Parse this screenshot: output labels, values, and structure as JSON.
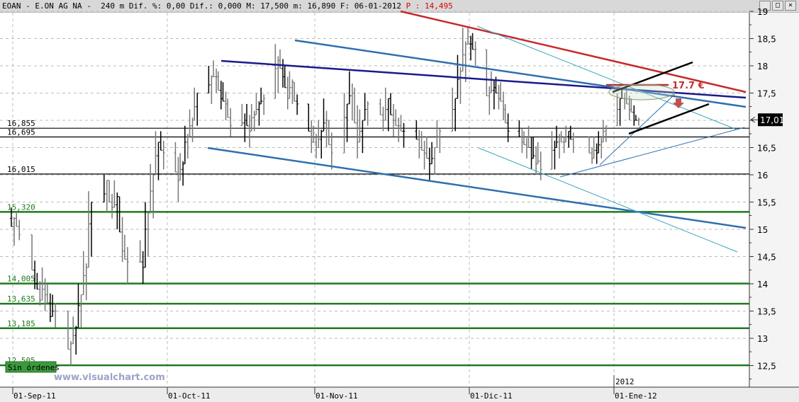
{
  "header": {
    "symbol": "EOAN - E.ON AG NA -",
    "stats": "240 m Dif. %: 0,00 Dif.: 0,000 M: 17,500 m: 16,890 F: 06-01-2012",
    "last": "P : 14,495",
    "window_buttons": [
      "minimize-icon",
      "maximize-icon",
      "close-icon"
    ]
  },
  "colors": {
    "support": "#1f7a1f",
    "resistance_red": "#c8282a",
    "navy": "#1a1a8c",
    "steel": "#2f6fae",
    "cyan": "#3aa7c0",
    "bars": "#000000"
  },
  "badge": "Sin órdenes",
  "watermark": "www.visualchart.com",
  "year_label": "2012",
  "annotation": "17.7 €",
  "chart_data": {
    "type": "ohlc",
    "interval": "240 m",
    "ylim": [
      12.2,
      19.0
    ],
    "yticks": [
      "19",
      "18,5",
      "18",
      "17,5",
      "17",
      "16,5",
      "16",
      "15,5",
      "15",
      "14,5",
      "14",
      "13,5",
      "13",
      "12,5"
    ],
    "ytick_values": [
      19,
      18.5,
      18,
      17.5,
      17,
      16.5,
      16,
      15.5,
      15,
      14.5,
      14,
      13.5,
      13,
      12.5
    ],
    "xticks": [
      {
        "date": "2011-09-01",
        "label": "01-Sep-11"
      },
      {
        "date": "2011-10-01",
        "label": "01-Oct-11"
      },
      {
        "date": "2011-11-01",
        "label": "01-Nov-11"
      },
      {
        "date": "2011-12-01",
        "label": "01-Dic-11"
      },
      {
        "date": "2012-01-01",
        "label": "01-Ene-12"
      }
    ],
    "grid": true,
    "current_price": "17,01",
    "levels": [
      {
        "value": 16.855,
        "label": "16,855",
        "color": "#000000"
      },
      {
        "value": 16.695,
        "label": "16,695",
        "color": "#000000"
      },
      {
        "value": 16.015,
        "label": "16,015",
        "color": "#000000"
      },
      {
        "value": 15.32,
        "label": "15,320",
        "color": "#1f7a1f"
      },
      {
        "value": 14.005,
        "label": "14,005",
        "color": "#1f7a1f"
      },
      {
        "value": 13.635,
        "label": "13,635",
        "color": "#1f7a1f"
      },
      {
        "value": 13.185,
        "label": "13,185",
        "color": "#1f7a1f"
      },
      {
        "value": 12.505,
        "label": "12,505",
        "color": "#1f7a1f"
      }
    ],
    "bars_hlc": [
      [
        "2011-09-01",
        15.4,
        14.7,
        15.2
      ],
      [
        "2011-09-02",
        15.3,
        14.8,
        14.9
      ],
      [
        "2011-09-05",
        14.6,
        13.9,
        14.0
      ],
      [
        "2011-09-06",
        14.2,
        13.6,
        13.7
      ],
      [
        "2011-09-07",
        14.3,
        13.5,
        13.8
      ],
      [
        "2011-09-08",
        14.0,
        13.3,
        13.4
      ],
      [
        "2011-09-09",
        13.8,
        13.2,
        13.5
      ],
      [
        "2011-09-12",
        13.1,
        12.5,
        12.9
      ],
      [
        "2011-09-13",
        13.4,
        12.7,
        13.2
      ],
      [
        "2011-09-14",
        14.0,
        13.2,
        13.8
      ],
      [
        "2011-09-15",
        14.6,
        13.7,
        14.3
      ],
      [
        "2011-09-16",
        15.7,
        14.5,
        15.5
      ],
      [
        "2011-09-19",
        16.0,
        15.3,
        15.9
      ],
      [
        "2011-09-20",
        15.8,
        15.2,
        15.4
      ],
      [
        "2011-09-21",
        15.9,
        15.0,
        15.6
      ],
      [
        "2011-09-22",
        15.5,
        14.4,
        14.6
      ],
      [
        "2011-09-23",
        14.9,
        14.0,
        14.4
      ],
      [
        "2011-09-26",
        14.8,
        14.0,
        14.3
      ],
      [
        "2011-09-27",
        15.5,
        14.5,
        15.3
      ],
      [
        "2011-09-28",
        16.2,
        15.2,
        16.0
      ],
      [
        "2011-09-29",
        16.8,
        15.9,
        16.6
      ],
      [
        "2011-09-30",
        16.8,
        16.1,
        16.4
      ],
      [
        "2011-10-03",
        16.6,
        15.5,
        15.9
      ],
      [
        "2011-10-04",
        16.4,
        15.8,
        16.2
      ],
      [
        "2011-10-05",
        16.9,
        16.3,
        16.7
      ],
      [
        "2011-10-06",
        17.2,
        16.6,
        17.0
      ],
      [
        "2011-10-07",
        17.6,
        16.9,
        17.5
      ],
      [
        "2011-10-10",
        18.0,
        17.3,
        17.8
      ],
      [
        "2011-10-11",
        18.1,
        17.5,
        17.8
      ],
      [
        "2011-10-12",
        17.9,
        17.2,
        17.4
      ],
      [
        "2011-10-13",
        17.7,
        17.0,
        17.3
      ],
      [
        "2011-10-14",
        17.4,
        16.7,
        16.9
      ],
      [
        "2011-10-17",
        17.3,
        16.6,
        17.0
      ],
      [
        "2011-10-18",
        17.3,
        16.5,
        16.8
      ],
      [
        "2011-10-19",
        17.3,
        16.8,
        17.1
      ],
      [
        "2011-10-20",
        17.5,
        16.9,
        17.3
      ],
      [
        "2011-10-21",
        17.6,
        17.1,
        17.4
      ],
      [
        "2011-10-24",
        18.4,
        17.5,
        18.1
      ],
      [
        "2011-10-25",
        18.3,
        17.6,
        17.8
      ],
      [
        "2011-10-26",
        18.0,
        17.2,
        17.4
      ],
      [
        "2011-10-27",
        17.9,
        17.3,
        17.7
      ],
      [
        "2011-10-28",
        17.6,
        17.1,
        17.3
      ],
      [
        "2011-10-31",
        17.2,
        16.4,
        16.6
      ],
      [
        "2011-11-01",
        16.9,
        16.3,
        16.5
      ],
      [
        "2011-11-02",
        17.0,
        16.3,
        16.8
      ],
      [
        "2011-11-03",
        17.4,
        16.5,
        17.0
      ],
      [
        "2011-11-04",
        17.0,
        16.1,
        16.4
      ],
      [
        "2011-11-07",
        17.5,
        16.6,
        17.3
      ],
      [
        "2011-11-08",
        17.9,
        17.0,
        17.5
      ],
      [
        "2011-11-09",
        17.6,
        16.3,
        16.6
      ],
      [
        "2011-11-10",
        17.2,
        16.4,
        17.0
      ],
      [
        "2011-11-11",
        17.5,
        16.9,
        17.3
      ],
      [
        "2011-11-14",
        17.4,
        16.8,
        17.0
      ],
      [
        "2011-11-15",
        17.6,
        16.8,
        17.4
      ],
      [
        "2011-11-16",
        17.5,
        16.7,
        17.0
      ],
      [
        "2011-11-17",
        17.2,
        16.6,
        16.9
      ],
      [
        "2011-11-18",
        17.1,
        16.5,
        16.8
      ],
      [
        "2011-11-21",
        17.0,
        16.3,
        16.5
      ],
      [
        "2011-11-22",
        16.8,
        16.1,
        16.4
      ],
      [
        "2011-11-23",
        16.7,
        15.9,
        16.2
      ],
      [
        "2011-11-24",
        16.6,
        16.0,
        16.5
      ],
      [
        "2011-11-25",
        17.0,
        16.4,
        16.8
      ],
      [
        "2011-11-28",
        17.6,
        16.8,
        17.4
      ],
      [
        "2011-11-29",
        18.2,
        17.3,
        17.9
      ],
      [
        "2011-11-30",
        18.7,
        17.7,
        18.4
      ],
      [
        "2011-12-01",
        18.7,
        18.1,
        18.4
      ],
      [
        "2011-12-02",
        18.6,
        18.0,
        18.3
      ],
      [
        "2011-12-05",
        17.8,
        17.1,
        17.5
      ],
      [
        "2011-12-06",
        17.9,
        17.2,
        17.6
      ],
      [
        "2011-12-07",
        17.8,
        17.2,
        17.4
      ],
      [
        "2011-12-08",
        17.7,
        17.0,
        17.2
      ],
      [
        "2011-12-09",
        17.3,
        16.6,
        16.8
      ],
      [
        "2011-12-12",
        17.0,
        16.4,
        16.6
      ],
      [
        "2011-12-13",
        16.8,
        16.3,
        16.5
      ],
      [
        "2011-12-14",
        16.9,
        16.1,
        16.3
      ],
      [
        "2011-12-15",
        16.7,
        16.0,
        16.2
      ],
      [
        "2011-12-16",
        16.6,
        15.9,
        16.1
      ],
      [
        "2011-12-19",
        16.8,
        16.1,
        16.5
      ],
      [
        "2011-12-20",
        16.9,
        16.3,
        16.7
      ],
      [
        "2011-12-21",
        16.8,
        16.4,
        16.6
      ],
      [
        "2011-12-22",
        16.9,
        16.5,
        16.8
      ],
      [
        "2011-12-23",
        16.9,
        16.4,
        16.7
      ],
      [
        "2011-12-27",
        16.6,
        16.2,
        16.3
      ],
      [
        "2011-12-28",
        16.7,
        16.2,
        16.4
      ],
      [
        "2011-12-29",
        16.8,
        16.3,
        16.6
      ],
      [
        "2011-12-30",
        17.0,
        16.6,
        16.9
      ],
      [
        "2012-01-02",
        17.5,
        16.9,
        17.4
      ],
      [
        "2012-01-03",
        17.6,
        17.2,
        17.4
      ],
      [
        "2012-01-04",
        17.6,
        17.0,
        17.2
      ],
      [
        "2012-01-05",
        17.4,
        16.9,
        17.0
      ],
      [
        "2012-01-06",
        17.1,
        16.9,
        17.01
      ]
    ]
  }
}
